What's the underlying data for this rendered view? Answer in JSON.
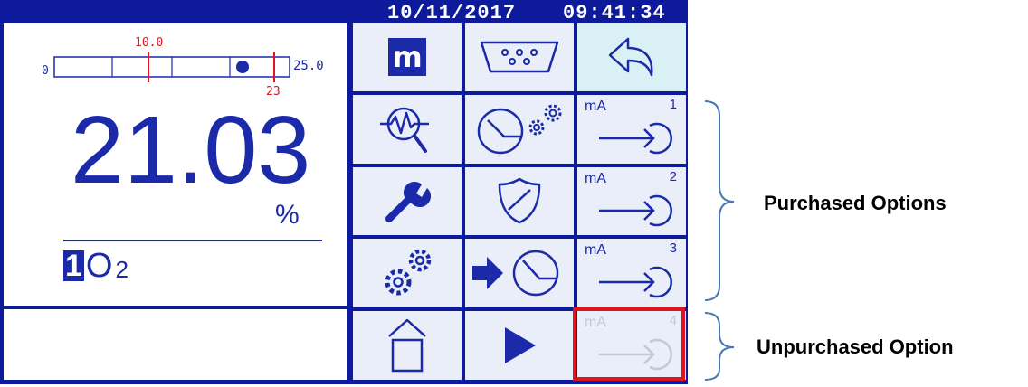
{
  "status": {
    "date": "10/11/2017",
    "time": "09:41:34"
  },
  "bar": {
    "min_label": "0",
    "max_label": "25.0",
    "setpoint_label": "10.0",
    "alarm_label": "23",
    "indicator_fraction": 0.8
  },
  "reading": {
    "value": "21.03",
    "unit": "%",
    "channel": "1",
    "gas_main": "O",
    "gas_sub": "2"
  },
  "menu": {
    "icons": [
      "m-menu-icon",
      "serial-port-icon",
      "back-arrow-icon",
      "diagnostics-magnifier-icon",
      "gauge-gears-icon",
      "wrench-icon",
      "shield-icon",
      "gears-icon",
      "arrow-gauge-icon",
      "home-icon",
      "play-icon"
    ],
    "m_label": "m",
    "outputs": [
      {
        "label": "mA",
        "number": "1",
        "enabled": true
      },
      {
        "label": "mA",
        "number": "2",
        "enabled": true
      },
      {
        "label": "mA",
        "number": "3",
        "enabled": true
      },
      {
        "label": "mA",
        "number": "4",
        "enabled": false
      }
    ]
  },
  "annotations": {
    "purchased": "Purchased Options",
    "unpurchased": "Unpurchased Option"
  },
  "colors": {
    "frame": "#0d1a9c",
    "ink": "#1a2aa8",
    "red": "#e0141e",
    "disabled": "#c4c8d4"
  }
}
